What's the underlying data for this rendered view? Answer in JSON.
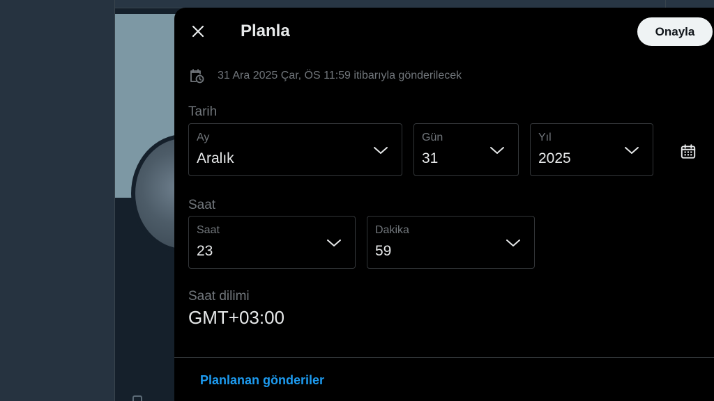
{
  "modal": {
    "title": "Planla",
    "confirm_label": "Onayla",
    "scheduled_text": "31 Ara 2025 Çar, ÖS 11:59 itibarıyla gönderilecek"
  },
  "date": {
    "section_label": "Tarih",
    "month": {
      "label": "Ay",
      "value": "Aralık"
    },
    "day": {
      "label": "Gün",
      "value": "31"
    },
    "year": {
      "label": "Yıl",
      "value": "2025"
    }
  },
  "time": {
    "section_label": "Saat",
    "hour": {
      "label": "Saat",
      "value": "23"
    },
    "minute": {
      "label": "Dakika",
      "value": "59"
    }
  },
  "timezone": {
    "label": "Saat dilimi",
    "value": "GMT+03:00"
  },
  "footer": {
    "link_label": "Planlanan gönderiler"
  },
  "colors": {
    "accent": "#1d9bf0",
    "modal_bg": "#000000",
    "backdrop": "#15202b"
  },
  "icons": [
    "close-icon",
    "calendar-clock-icon",
    "chevron-down-icon",
    "calendar-icon"
  ]
}
